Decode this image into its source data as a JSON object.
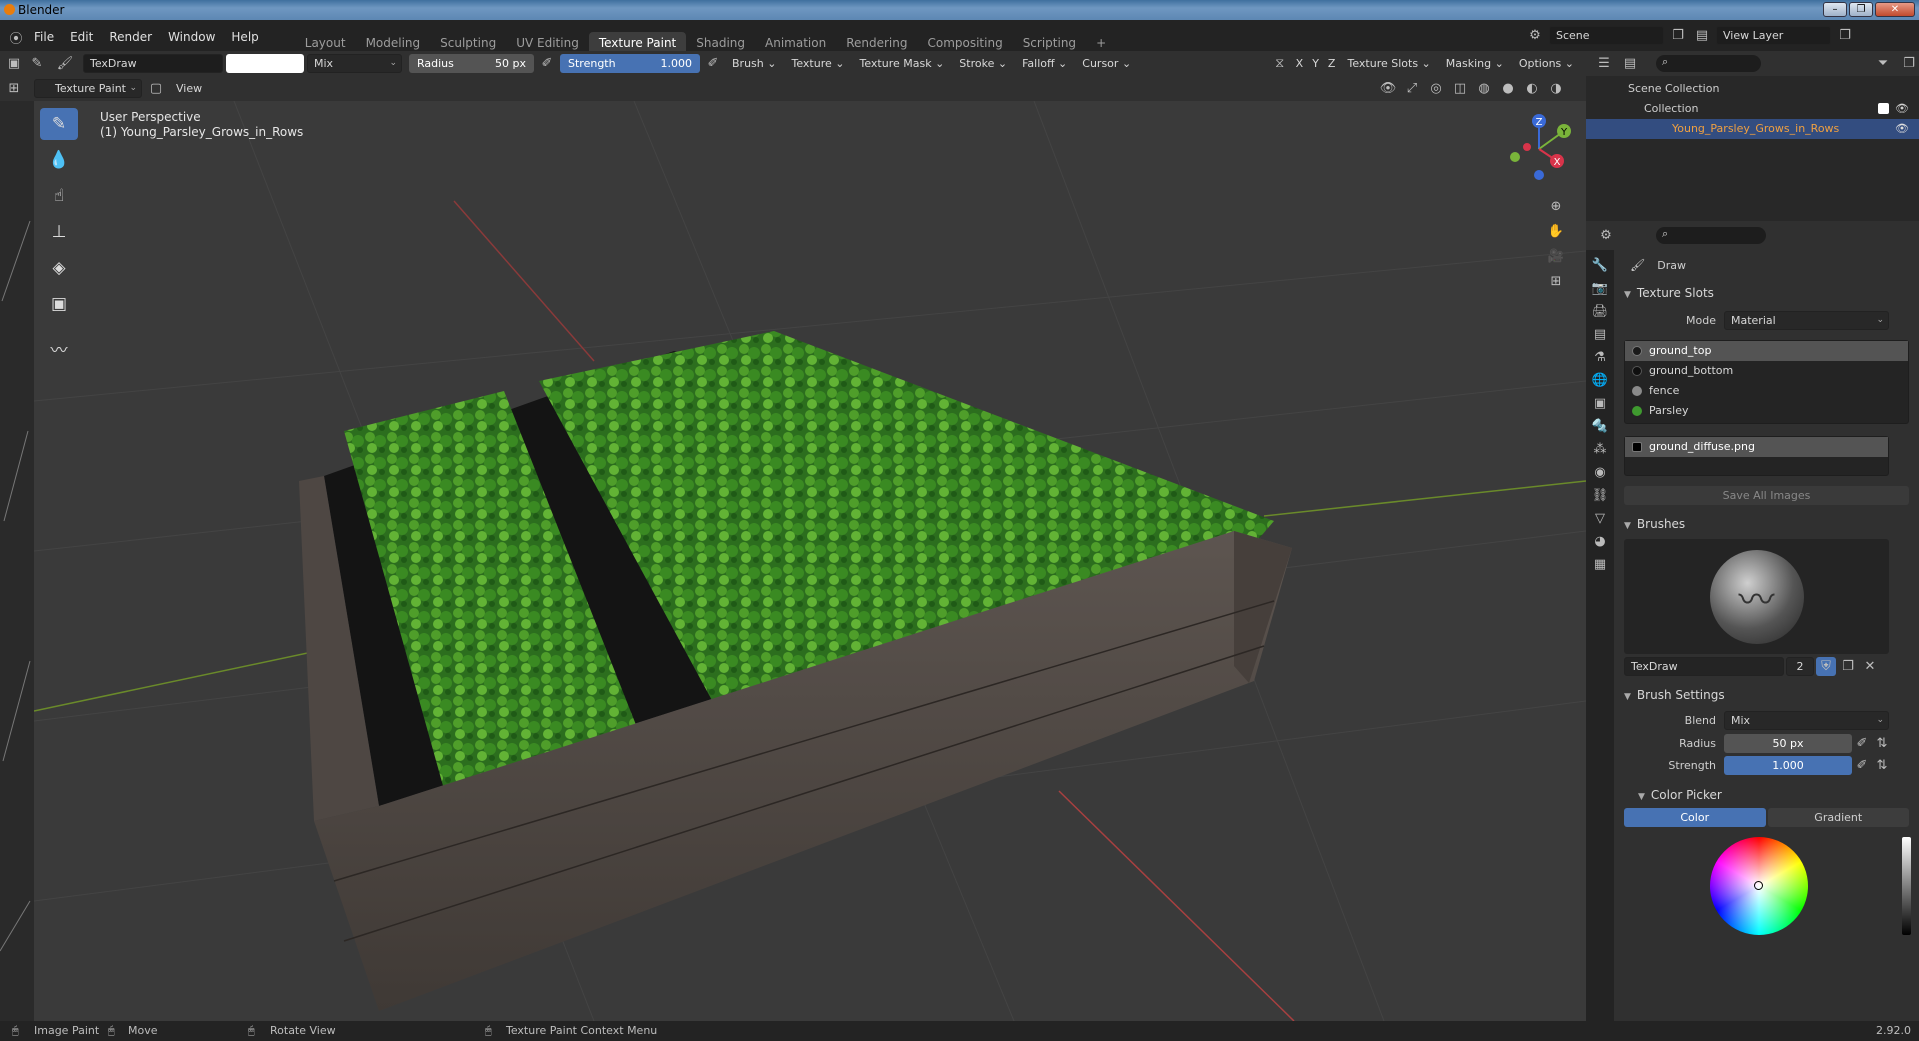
{
  "window": {
    "title": "Blender",
    "controls": [
      "–",
      "❐",
      "✕"
    ]
  },
  "menu": [
    "File",
    "Edit",
    "Render",
    "Window",
    "Help"
  ],
  "workspaces": [
    "Layout",
    "Modeling",
    "Sculpting",
    "UV Editing",
    "Texture Paint",
    "Shading",
    "Animation",
    "Rendering",
    "Compositing",
    "Scripting"
  ],
  "active_workspace": "Texture Paint",
  "add_workspace": "+",
  "scene": "Scene",
  "view_layer": "View Layer",
  "tool_header": {
    "brush_name": "TexDraw",
    "blend": "Mix",
    "radius_label": "Radius",
    "radius_value": "50 px",
    "strength_label": "Strength",
    "strength_value": "1.000",
    "strength_fraction": 1.0,
    "menus": [
      "Brush",
      "Texture",
      "Texture Mask",
      "Stroke",
      "Falloff",
      "Cursor"
    ],
    "axes": [
      "X",
      "Y",
      "Z"
    ],
    "right_menus": [
      "Texture Slots",
      "Masking",
      "Options"
    ]
  },
  "mode_header": {
    "mode": "Texture Paint",
    "view": "View"
  },
  "viewport": {
    "perspective": "User Perspective",
    "object": "(1) Young_Parsley_Grows_in_Rows",
    "gizmo": {
      "z": "Z",
      "y": "Y",
      "x": "X"
    }
  },
  "outliner": {
    "root": "Scene Collection",
    "collection": "Collection",
    "object": "Young_Parsley_Grows_in_Rows"
  },
  "properties": {
    "tool_name": "Draw",
    "texture_slots": {
      "title": "Texture Slots",
      "mode_label": "Mode",
      "mode": "Material",
      "materials": [
        {
          "name": "ground_top",
          "color": "#1a1a1a"
        },
        {
          "name": "ground_bottom",
          "color": "#0f0f0f"
        },
        {
          "name": "fence",
          "color": "#8a8a8a"
        },
        {
          "name": "Parsley",
          "color": "#3f9a2f"
        }
      ],
      "image": "ground_diffuse.png",
      "save_all": "Save All Images"
    },
    "brushes": {
      "title": "Brushes",
      "name": "TexDraw",
      "users": "2"
    },
    "brush_settings": {
      "title": "Brush Settings",
      "blend_label": "Blend",
      "blend": "Mix",
      "radius_label": "Radius",
      "radius": "50 px",
      "strength_label": "Strength",
      "strength": "1.000"
    },
    "color_picker": {
      "title": "Color Picker",
      "tabs": [
        "Color",
        "Gradient"
      ]
    }
  },
  "status": {
    "left1": "Image Paint",
    "left2": "Move",
    "mid": "Rotate View",
    "context": "Texture Paint Context Menu",
    "version": "2.92.0"
  },
  "colors": {
    "accent": "#4772b3",
    "panel": "#303030",
    "viewport": "#3a3a3a"
  }
}
